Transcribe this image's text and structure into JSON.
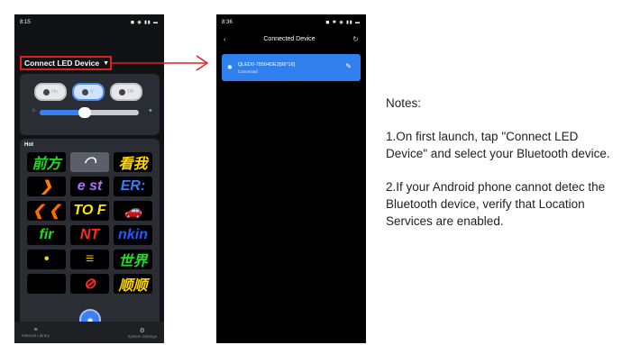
{
  "phone1": {
    "status_time": "8:15",
    "status_icons": "◼ ◉ ▮▮ ▬",
    "connect_label": "Connect LED Device",
    "toggles": [
      {
        "label": "On",
        "active": false
      },
      {
        "label": "6°",
        "active": true
      },
      {
        "label": "Off",
        "active": false
      }
    ],
    "brightness_percent": 45,
    "hot_title": "Hot",
    "tiles": [
      {
        "text": "前方",
        "color": "#22dd22",
        "light": false
      },
      {
        "text": "◠",
        "color": "#ffffff",
        "light": true
      },
      {
        "text": "看我",
        "color": "#ffd700",
        "light": false
      },
      {
        "text": "❯",
        "color": "#ff7a00",
        "light": false
      },
      {
        "text": "e st",
        "color": "#b16cff",
        "light": false
      },
      {
        "text": "ER:",
        "color": "#3b7bff",
        "light": false
      },
      {
        "text": "❮ ❮",
        "color": "#ff6a00",
        "light": false
      },
      {
        "text": "TO F",
        "color": "#ffe600",
        "light": false
      },
      {
        "text": "🚗",
        "color": "#5ac8fa",
        "light": false
      },
      {
        "text": "fir",
        "color": "#22dd22",
        "light": false
      },
      {
        "text": "NT",
        "color": "#ff2a2a",
        "light": false
      },
      {
        "text": "nkin",
        "color": "#1f5cff",
        "light": false
      },
      {
        "text": "•",
        "color": "#ffd700",
        "light": false
      },
      {
        "text": "≡",
        "color": "#d4b000",
        "light": false
      },
      {
        "text": "世界",
        "color": "#22dd22",
        "light": false
      },
      {
        "text": "",
        "color": "#000000",
        "light": false
      },
      {
        "text": "⊘",
        "color": "#ff2a2a",
        "light": false
      },
      {
        "text": "顺顺",
        "color": "#ffd700",
        "light": false
      }
    ],
    "nav_left": "Material Library",
    "nav_right": "System Settings",
    "nav_left_icon": "≡",
    "nav_right_icon": "⚙",
    "fab_icon": "◉"
  },
  "phone2": {
    "status_time": "8:36",
    "status_icons": "◼ ✱ ◉ ▮▮ ▬",
    "title": "Connected Device",
    "back_icon": "‹",
    "refresh_icon": "↻",
    "device_name": "QLED0-78504DE3[96*16]",
    "device_status": "Connected",
    "bt_icon": "✱",
    "edit_icon": "✎"
  },
  "notes": {
    "heading": "Notes:",
    "note1": "1.On first launch, tap \"Connect LED Device\" and select your Bluetooth device.",
    "note2": "2.If your Android phone cannot detec the Bluetooth device, verify that Location Services are enabled."
  },
  "colors": {
    "accent": "#2f80ed",
    "highlight": "#e02020"
  }
}
